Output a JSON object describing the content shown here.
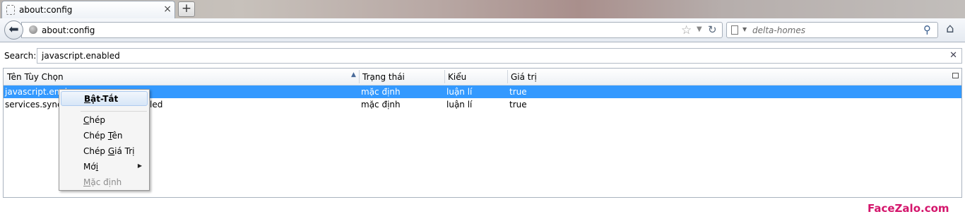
{
  "tab": {
    "title": "about:config",
    "close_icon": "×"
  },
  "new_tab": {
    "icon": "+"
  },
  "navbar": {
    "url": "about:config",
    "search_placeholder": "delta-homes"
  },
  "filter": {
    "label": "Search:",
    "value": "javascript.enabled",
    "clear_icon": "✕"
  },
  "columns": [
    "Tên Tùy Chọn",
    "Trạng thái",
    "Kiểu",
    "Giá trị"
  ],
  "rows": [
    {
      "name": "javascript.enab",
      "status": "mặc định",
      "type": "luận lí",
      "value": "true",
      "selected": true
    },
    {
      "name_start": "services.sync.p",
      "name_end": "led",
      "status": "mặc định",
      "type": "luận lí",
      "value": "true",
      "selected": false
    }
  ],
  "context_menu": {
    "items": [
      {
        "pre": "",
        "key": "B",
        "post": "ật-Tắt",
        "highlighted": true
      },
      {
        "pre": "",
        "key": "C",
        "post": "hép"
      },
      {
        "pre": "Chép ",
        "key": "T",
        "post": "ên"
      },
      {
        "pre": "Chép ",
        "key": "G",
        "post": "iá Trị"
      },
      {
        "pre": "Mớ",
        "key": "i",
        "post": "",
        "submenu": true
      },
      {
        "pre": "",
        "key": "M",
        "post": "ặc định",
        "disabled": true
      }
    ]
  },
  "watermark": "FaceZalo.com",
  "colors": {
    "selection": "#3399ff",
    "watermark": "#d4166c"
  }
}
